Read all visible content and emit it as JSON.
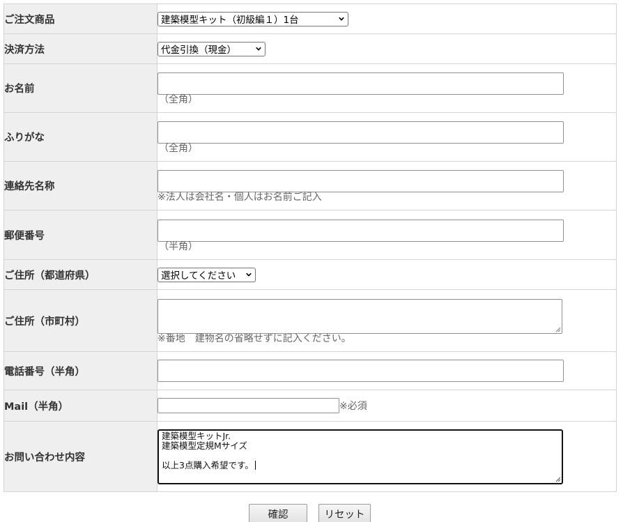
{
  "form": {
    "product": {
      "label": "ご注文商品",
      "selected": "建築模型キット（初級編１）1台"
    },
    "payment": {
      "label": "決済方法",
      "selected": "代金引換（現金）"
    },
    "name": {
      "label": "お名前",
      "value": "",
      "note": "（全角）"
    },
    "furigana": {
      "label": "ふりがな",
      "value": "",
      "note": "（全角）"
    },
    "contact_name": {
      "label": "連絡先名称",
      "value": "",
      "note": "※法人は会社名・個人はお名前ご記入"
    },
    "postal": {
      "label": "郵便番号",
      "value": "",
      "note": "（半角）"
    },
    "prefecture": {
      "label": "ご住所（都道府県）",
      "selected": "選択してください"
    },
    "city": {
      "label": "ご住所（市町村）",
      "value": "",
      "note": "※番地　建物名の省略せずに記入ください。"
    },
    "phone": {
      "label": "電話番号（半角）",
      "value": ""
    },
    "mail": {
      "label": "Mail（半角）",
      "value": "",
      "note": "※必須"
    },
    "inquiry": {
      "label": "お問い合わせ内容",
      "value": "建築模型キットJr.\n建築模型定規Mサイズ\n\n以上3点購入希望です。"
    }
  },
  "buttons": {
    "confirm": "確認",
    "reset": "リセット"
  },
  "colors": {
    "label_bg": "#efefef",
    "border": "#d3d3d3",
    "note_text": "#666666"
  },
  "icons": {
    "select_arrow": "chevron-down-icon",
    "resize": "resize-grip-icon"
  }
}
